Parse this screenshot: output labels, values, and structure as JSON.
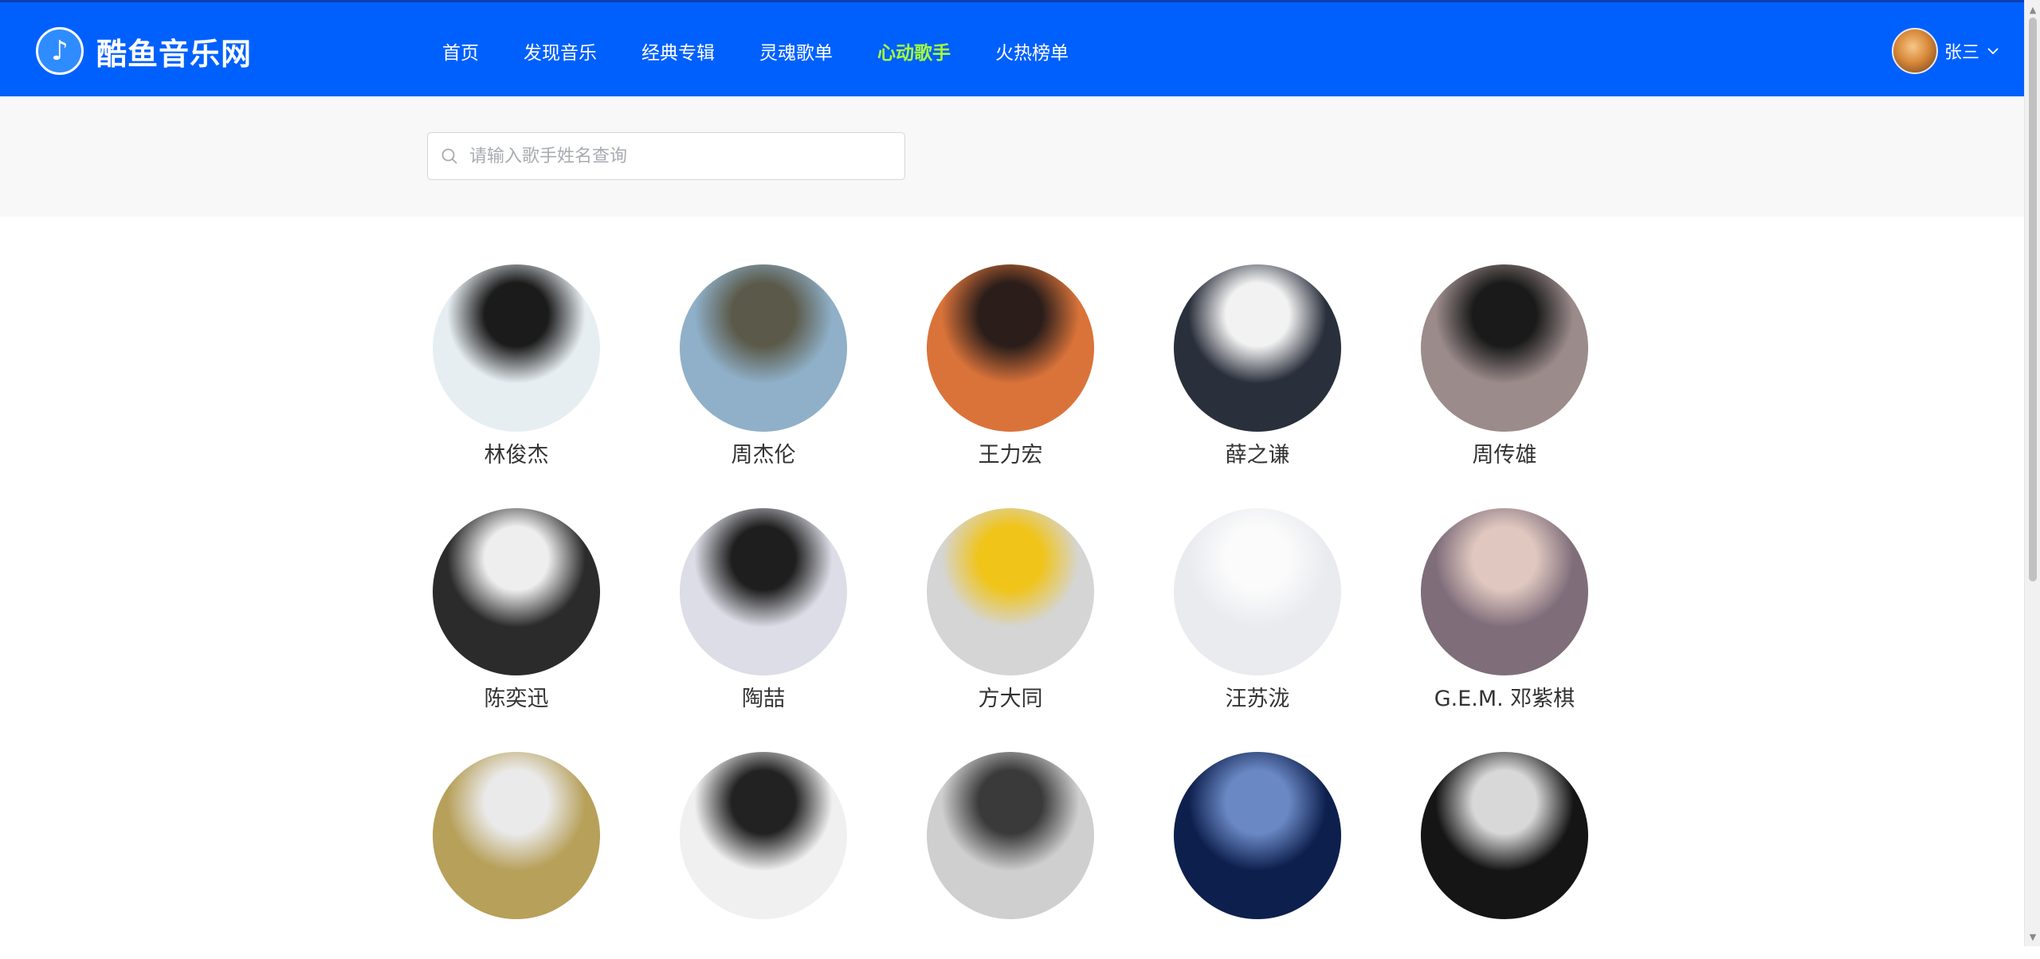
{
  "header": {
    "logo_text": "酷鱼音乐网",
    "logo_glyph": "♪",
    "nav": [
      {
        "label": "首页",
        "active": false
      },
      {
        "label": "发现音乐",
        "active": false
      },
      {
        "label": "经典专辑",
        "active": false
      },
      {
        "label": "灵魂歌单",
        "active": false
      },
      {
        "label": "心动歌手",
        "active": true
      },
      {
        "label": "火热榜单",
        "active": false
      }
    ],
    "user_name": "张三",
    "colors": {
      "bar": "#0060fe",
      "active_nav": "#a6ff3a"
    }
  },
  "search": {
    "placeholder": "请输入歌手姓名查询",
    "value": ""
  },
  "singers": [
    {
      "name": "林俊杰",
      "bg1": "#e7eef2",
      "bg2": "#1b1b1b"
    },
    {
      "name": "周杰伦",
      "bg1": "#8fb0c8",
      "bg2": "#5b5a4a"
    },
    {
      "name": "王力宏",
      "bg1": "#d9733a",
      "bg2": "#2a1d1a"
    },
    {
      "name": "薛之谦",
      "bg1": "#2a2f3c",
      "bg2": "#f2f2f2"
    },
    {
      "name": "周传雄",
      "bg1": "#9c8b8b",
      "bg2": "#1a1a1a"
    },
    {
      "name": "陈奕迅",
      "bg1": "#2b2b2b",
      "bg2": "#eeeeee"
    },
    {
      "name": "陶喆",
      "bg1": "#dcdde6",
      "bg2": "#1e1e1e"
    },
    {
      "name": "方大同",
      "bg1": "#d5d5d5",
      "bg2": "#f0c419"
    },
    {
      "name": "汪苏泷",
      "bg1": "#e9ebef",
      "bg2": "#fbfbfb"
    },
    {
      "name": "G.E.M. 邓紫棋",
      "bg1": "#7f6d7a",
      "bg2": "#e0c8c0"
    },
    {
      "name": "",
      "bg1": "#b7a05a",
      "bg2": "#eaeaea"
    },
    {
      "name": "",
      "bg1": "#f0f0f0",
      "bg2": "#222222"
    },
    {
      "name": "",
      "bg1": "#cfcfcf",
      "bg2": "#3a3a3a"
    },
    {
      "name": "",
      "bg1": "#0d1f4d",
      "bg2": "#6a88c4"
    },
    {
      "name": "",
      "bg1": "#151515",
      "bg2": "#d8d8d8"
    }
  ]
}
